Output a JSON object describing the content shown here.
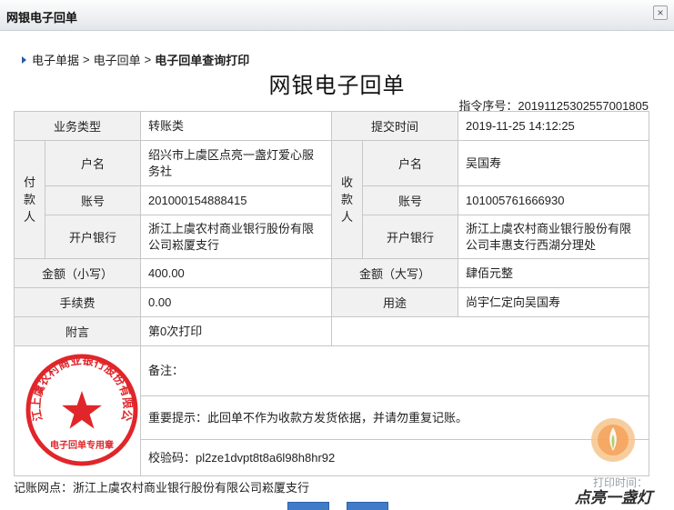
{
  "window": {
    "title": "网银电子回单",
    "close_glyph": "×"
  },
  "breadcrumb": {
    "items": [
      "电子单据",
      "电子回单"
    ],
    "current": "电子回单查询打印",
    "separator": ">"
  },
  "heading": "网银电子回单",
  "serial": "指令序号：20191125302557001805",
  "table": {
    "business_type_label": "业务类型",
    "business_type": "转账类",
    "submit_time_label": "提交时间",
    "submit_time": "2019-11-25 14:12:25",
    "payer": {
      "side_label": "付款人",
      "name_label": "户名",
      "name": "绍兴市上虞区点亮一盏灯爱心服务社",
      "account_label": "账号",
      "account": "201000154888415",
      "bank_label": "开户银行",
      "bank": "浙江上虞农村商业银行股份有限公司崧厦支行"
    },
    "payee": {
      "side_label": "收款人",
      "name_label": "户名",
      "name": "吴国寿",
      "account_label": "账号",
      "account": "101005761666930",
      "bank_label": "开户银行",
      "bank": "浙江上虞农村商业银行股份有限公司丰惠支行西湖分理处"
    },
    "amount_small_label": "金额（小写）",
    "amount_small": "400.00",
    "amount_big_label": "金额（大写）",
    "amount_big": "肆佰元整",
    "fee_label": "手续费",
    "fee": "0.00",
    "purpose_label": "用途",
    "purpose": "尚宇仁定向吴国寿",
    "note_label": "附言",
    "note": "第0次打印",
    "remark": "备注：",
    "tip": "重要提示：此回单不作为收款方发货依据，并请勿重复记账。",
    "checkcode": "校验码：pl2ze1dvpt8t8a6l98h8hr92"
  },
  "seal": {
    "ring_text": "浙江上虞农村商业银行股份有限公司",
    "bottom_text": "电子回单专用章",
    "color": "#e0262a"
  },
  "footer": "记账网点：浙江上虞农村商业银行股份有限公司崧厦支行",
  "print_time_partial": "打印时间：",
  "watermark": {
    "text": "点亮一盏灯"
  },
  "colors": {
    "header_bg": "#f1f1f1",
    "border": "#c7c7c7",
    "button": "#3f7bc9",
    "link_arrow": "#2a5aa8"
  }
}
